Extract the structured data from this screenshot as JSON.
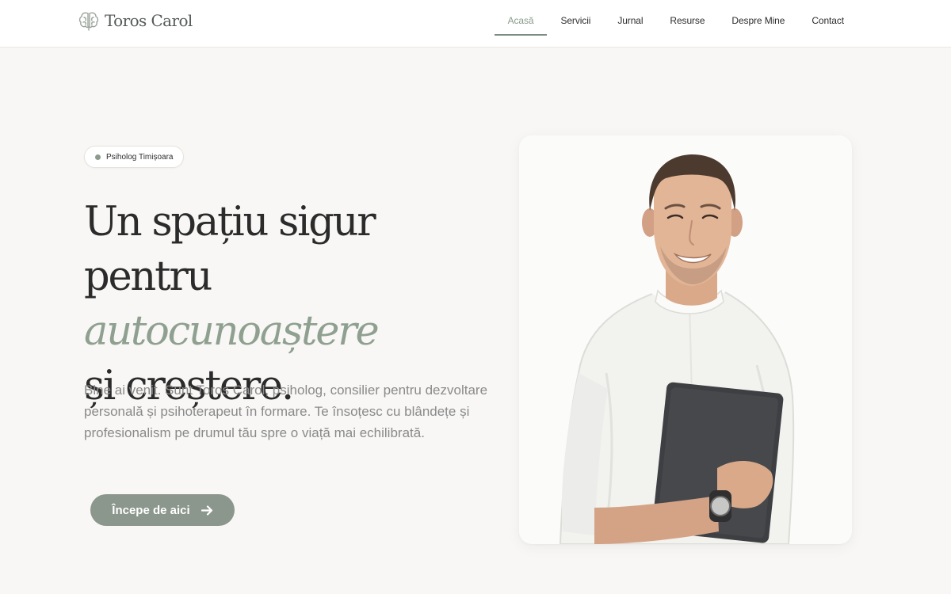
{
  "brand": {
    "name": "Toros Carol",
    "icon": "brain-icon"
  },
  "nav": {
    "items": [
      {
        "label": "Acasă",
        "active": true
      },
      {
        "label": "Servicii",
        "active": false
      },
      {
        "label": "Jurnal",
        "active": false
      },
      {
        "label": "Resurse",
        "active": false
      },
      {
        "label": "Despre Mine",
        "active": false
      },
      {
        "label": "Contact",
        "active": false
      }
    ]
  },
  "hero": {
    "badge": "Psiholog Timișoara",
    "headline": {
      "line1": "Un spațiu sigur",
      "line2_prefix": "pentru ",
      "line2_accent": "autocunoaștere",
      "line3": "și creștere."
    },
    "intro": "Bine ai venit. Sunt Toros Carol, psiholog, consilier pentru dezvoltare personală și psihoterapeut în formare. Te însoțesc cu blândețe și profesionalism pe drumul tău spre o viață mai echilibrată.",
    "cta_label": "Începe de aici",
    "cta_icon": "arrow-right-icon",
    "photo": "portrait-photo"
  },
  "colors": {
    "accent": "#8fa090",
    "button": "#8b968c",
    "background": "#f8f7f5",
    "text": "#2b2b2b",
    "muted_text": "#8a8a8a"
  }
}
